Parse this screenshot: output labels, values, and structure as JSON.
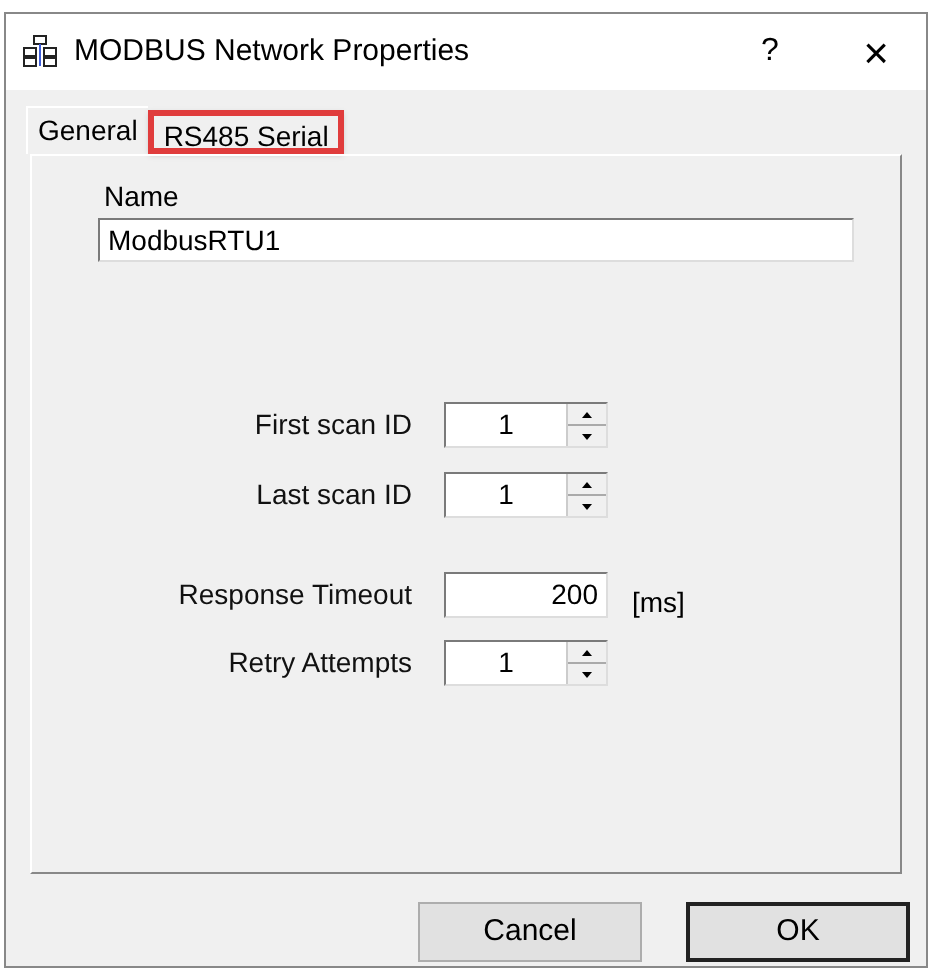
{
  "window": {
    "title": "MODBUS Network Properties",
    "help": "?",
    "close": "×"
  },
  "tabs": [
    {
      "label": "General",
      "selected": true,
      "highlighted": false
    },
    {
      "label": "RS485 Serial",
      "selected": false,
      "highlighted": true
    }
  ],
  "name_field": {
    "label": "Name",
    "value": "ModbusRTU1"
  },
  "fields": [
    {
      "kind": "spinner",
      "label": "First scan ID",
      "value": "1"
    },
    {
      "kind": "spinner",
      "label": "Last scan ID",
      "value": "1"
    },
    {
      "kind": "text",
      "label": "Response Timeout",
      "value": "200",
      "unit": "[ms]"
    },
    {
      "kind": "spinner",
      "label": "Retry Attempts",
      "value": "1"
    }
  ],
  "buttons": [
    {
      "label": "Cancel",
      "default": false
    },
    {
      "label": "OK",
      "default": true
    }
  ]
}
